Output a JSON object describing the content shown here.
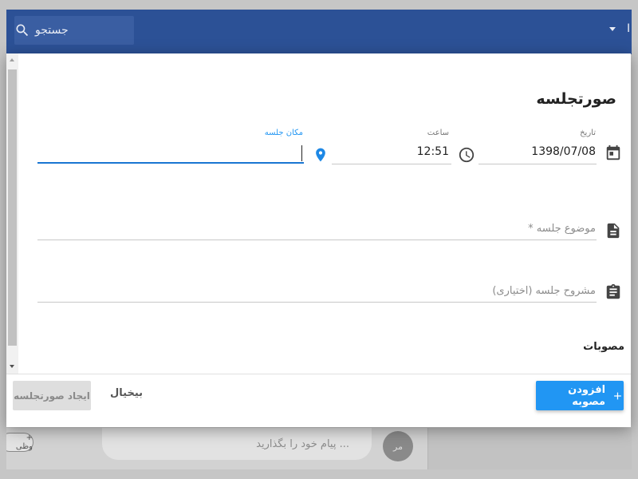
{
  "appbar": {
    "search_label": "جستجو",
    "user_letter": "ا",
    "color": "#2c5196"
  },
  "background": {
    "tag_label": "+ وظی",
    "message_placeholder": "پیام خود را بگذارید ...",
    "avatar_text": "مر"
  },
  "dialog": {
    "title": "صورتجلسه",
    "date": {
      "label": "تاریخ",
      "value": "1398/07/08",
      "icon": "calendar-icon"
    },
    "time": {
      "label": "ساعت",
      "value": "12:51",
      "icon": "clock-icon"
    },
    "location": {
      "label": "مکان جلسه",
      "value": "",
      "icon": "location-pin-icon"
    },
    "subject": {
      "placeholder": "موضوع جلسه *",
      "icon": "document-icon"
    },
    "description": {
      "placeholder": "مشروح جلسه (اختیاری)",
      "icon": "clipboard-icon"
    },
    "approvals_heading": "مصوبات",
    "buttons": {
      "add_approval": "افزودن مصوبه",
      "cancel": "بیخیال",
      "create": "ایجاد صورتجلسه"
    },
    "accent": "#2196f3"
  }
}
